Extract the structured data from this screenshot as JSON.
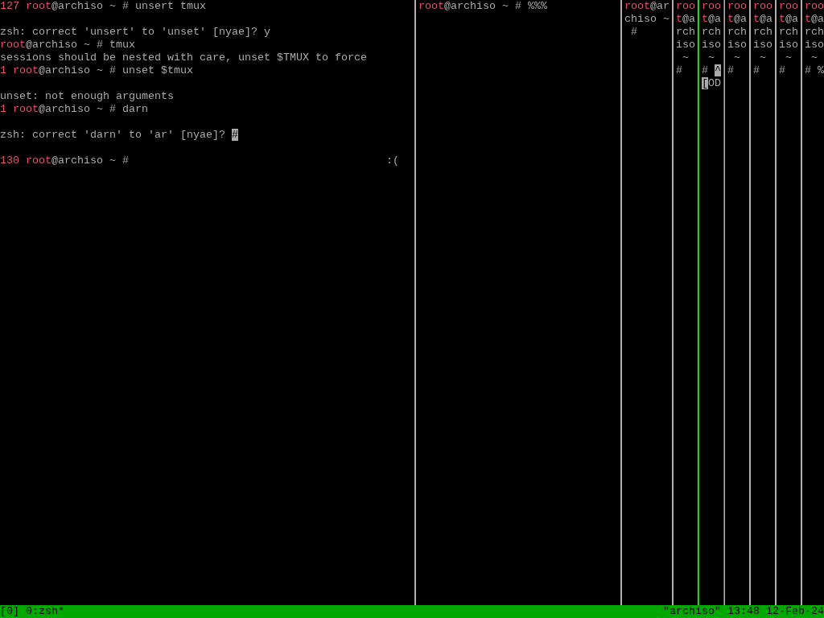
{
  "panes": [
    {
      "active": false,
      "lines": [
        {
          "kind": "text",
          "segments": [
            {
              "text": "127 root",
              "kind": "red"
            },
            {
              "text": "@archiso ~ # unsert tmux",
              "kind": "plain"
            }
          ]
        },
        {
          "kind": "blank"
        },
        {
          "kind": "text",
          "segments": [
            {
              "text": "zsh: correct 'unsert' to 'unset' [nyae]? y",
              "kind": "plain"
            }
          ]
        },
        {
          "kind": "text",
          "segments": [
            {
              "text": "root",
              "kind": "red"
            },
            {
              "text": "@archiso ~ # tmux",
              "kind": "plain"
            }
          ]
        },
        {
          "kind": "text",
          "segments": [
            {
              "text": "sessions should be nested with care, unset $TMUX to force",
              "kind": "plain"
            }
          ]
        },
        {
          "kind": "text",
          "segments": [
            {
              "text": "1 root",
              "kind": "red"
            },
            {
              "text": "@archiso ~ # unset $tmux",
              "kind": "plain"
            }
          ]
        },
        {
          "kind": "blank"
        },
        {
          "kind": "text",
          "segments": [
            {
              "text": "unset: not enough arguments",
              "kind": "plain"
            }
          ]
        },
        {
          "kind": "text",
          "segments": [
            {
              "text": "1 root",
              "kind": "red"
            },
            {
              "text": "@archiso ~ # darn",
              "kind": "plain"
            }
          ]
        },
        {
          "kind": "blank"
        },
        {
          "kind": "text",
          "segments": [
            {
              "text": "zsh: correct 'darn' to 'ar' [nyae]? ",
              "kind": "plain"
            },
            {
              "text": "#",
              "kind": "cursor"
            }
          ]
        },
        {
          "kind": "blank"
        },
        {
          "kind": "text",
          "segments": [
            {
              "text": "130 root",
              "kind": "red"
            },
            {
              "text": "@archiso ~ #",
              "kind": "plain"
            },
            {
              "text": ":(",
              "kind": "right"
            }
          ]
        }
      ]
    },
    {
      "active": false,
      "lines": [
        {
          "kind": "text",
          "segments": [
            {
              "text": "root",
              "kind": "red"
            },
            {
              "text": "@archiso ~ # %%%",
              "kind": "plain"
            }
          ]
        }
      ]
    },
    {
      "active": false,
      "lines": [
        {
          "kind": "text",
          "segments": [
            {
              "text": "root",
              "kind": "red"
            },
            {
              "text": "@ar",
              "kind": "plain"
            }
          ]
        },
        {
          "kind": "text",
          "segments": [
            {
              "text": "chiso ~",
              "kind": "plain"
            }
          ]
        },
        {
          "kind": "text",
          "segments": [
            {
              "text": " #",
              "kind": "plain"
            }
          ]
        }
      ]
    },
    {
      "active": false,
      "lines": [
        {
          "kind": "text",
          "segments": [
            {
              "text": "roo",
              "kind": "red"
            }
          ]
        },
        {
          "kind": "text",
          "segments": [
            {
              "text": "t",
              "kind": "red"
            },
            {
              "text": "@a",
              "kind": "plain"
            }
          ]
        },
        {
          "kind": "text",
          "segments": [
            {
              "text": "rch",
              "kind": "plain"
            }
          ]
        },
        {
          "kind": "text",
          "segments": [
            {
              "text": "iso",
              "kind": "plain"
            }
          ]
        },
        {
          "kind": "text",
          "segments": [
            {
              "text": " ~",
              "kind": "plain"
            }
          ]
        },
        {
          "kind": "text",
          "segments": [
            {
              "text": "#",
              "kind": "plain"
            }
          ]
        }
      ]
    },
    {
      "active": true,
      "lines": [
        {
          "kind": "text",
          "segments": [
            {
              "text": "roo",
              "kind": "red"
            }
          ]
        },
        {
          "kind": "text",
          "segments": [
            {
              "text": "t",
              "kind": "red"
            },
            {
              "text": "@a",
              "kind": "plain"
            }
          ]
        },
        {
          "kind": "text",
          "segments": [
            {
              "text": "rch",
              "kind": "plain"
            }
          ]
        },
        {
          "kind": "text",
          "segments": [
            {
              "text": "iso",
              "kind": "plain"
            }
          ]
        },
        {
          "kind": "text",
          "segments": [
            {
              "text": " ~",
              "kind": "plain"
            }
          ]
        },
        {
          "kind": "text",
          "segments": [
            {
              "text": "# ",
              "kind": "plain"
            },
            {
              "text": "^",
              "kind": "cursor"
            }
          ]
        },
        {
          "kind": "text",
          "segments": [
            {
              "text": "[",
              "kind": "cursor"
            },
            {
              "text": "OD",
              "kind": "plain"
            }
          ]
        }
      ]
    },
    {
      "active": false,
      "lines": [
        {
          "kind": "text",
          "segments": [
            {
              "text": "roo",
              "kind": "red"
            }
          ]
        },
        {
          "kind": "text",
          "segments": [
            {
              "text": "t",
              "kind": "red"
            },
            {
              "text": "@a",
              "kind": "plain"
            }
          ]
        },
        {
          "kind": "text",
          "segments": [
            {
              "text": "rch",
              "kind": "plain"
            }
          ]
        },
        {
          "kind": "text",
          "segments": [
            {
              "text": "iso",
              "kind": "plain"
            }
          ]
        },
        {
          "kind": "text",
          "segments": [
            {
              "text": " ~",
              "kind": "plain"
            }
          ]
        },
        {
          "kind": "text",
          "segments": [
            {
              "text": "#",
              "kind": "plain"
            }
          ]
        }
      ]
    },
    {
      "active": false,
      "lines": [
        {
          "kind": "text",
          "segments": [
            {
              "text": "roo",
              "kind": "red"
            }
          ]
        },
        {
          "kind": "text",
          "segments": [
            {
              "text": "t",
              "kind": "red"
            },
            {
              "text": "@a",
              "kind": "plain"
            }
          ]
        },
        {
          "kind": "text",
          "segments": [
            {
              "text": "rch",
              "kind": "plain"
            }
          ]
        },
        {
          "kind": "text",
          "segments": [
            {
              "text": "iso",
              "kind": "plain"
            }
          ]
        },
        {
          "kind": "text",
          "segments": [
            {
              "text": " ~",
              "kind": "plain"
            }
          ]
        },
        {
          "kind": "text",
          "segments": [
            {
              "text": "#",
              "kind": "plain"
            }
          ]
        }
      ]
    },
    {
      "active": false,
      "lines": [
        {
          "kind": "text",
          "segments": [
            {
              "text": "roo",
              "kind": "red"
            }
          ]
        },
        {
          "kind": "text",
          "segments": [
            {
              "text": "t",
              "kind": "red"
            },
            {
              "text": "@a",
              "kind": "plain"
            }
          ]
        },
        {
          "kind": "text",
          "segments": [
            {
              "text": "rch",
              "kind": "plain"
            }
          ]
        },
        {
          "kind": "text",
          "segments": [
            {
              "text": "iso",
              "kind": "plain"
            }
          ]
        },
        {
          "kind": "text",
          "segments": [
            {
              "text": " ~",
              "kind": "plain"
            }
          ]
        },
        {
          "kind": "text",
          "segments": [
            {
              "text": "#",
              "kind": "plain"
            }
          ]
        }
      ]
    },
    {
      "active": false,
      "lines": [
        {
          "kind": "text",
          "segments": [
            {
              "text": "roo",
              "kind": "red"
            }
          ]
        },
        {
          "kind": "text",
          "segments": [
            {
              "text": "t",
              "kind": "red"
            },
            {
              "text": "@a",
              "kind": "plain"
            }
          ]
        },
        {
          "kind": "text",
          "segments": [
            {
              "text": "rch",
              "kind": "plain"
            }
          ]
        },
        {
          "kind": "text",
          "segments": [
            {
              "text": "iso",
              "kind": "plain"
            }
          ]
        },
        {
          "kind": "text",
          "segments": [
            {
              "text": " ~",
              "kind": "plain"
            }
          ]
        },
        {
          "kind": "text",
          "segments": [
            {
              "text": "# %",
              "kind": "plain"
            }
          ]
        }
      ]
    }
  ],
  "status_bar": {
    "session": "[0]",
    "window": "0:zsh*",
    "host": "\"archiso\"",
    "time": "13:48",
    "date": "12-Feb-24"
  }
}
